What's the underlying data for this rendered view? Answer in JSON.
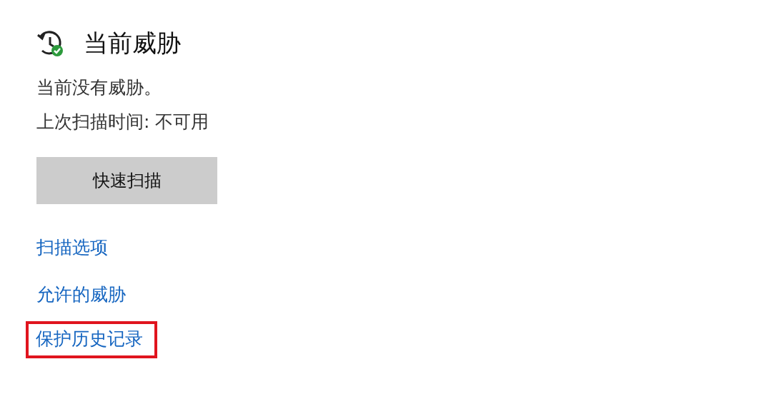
{
  "section": {
    "title": "当前威胁"
  },
  "status_lines": [
    "当前没有威胁。",
    "上次扫描时间: 不可用"
  ],
  "scan_button": {
    "label": "快速扫描"
  },
  "links": [
    {
      "label": "扫描选项",
      "highlighted": false
    },
    {
      "label": "允许的威胁",
      "highlighted": false
    },
    {
      "label": "保护历史记录",
      "highlighted": true
    }
  ]
}
